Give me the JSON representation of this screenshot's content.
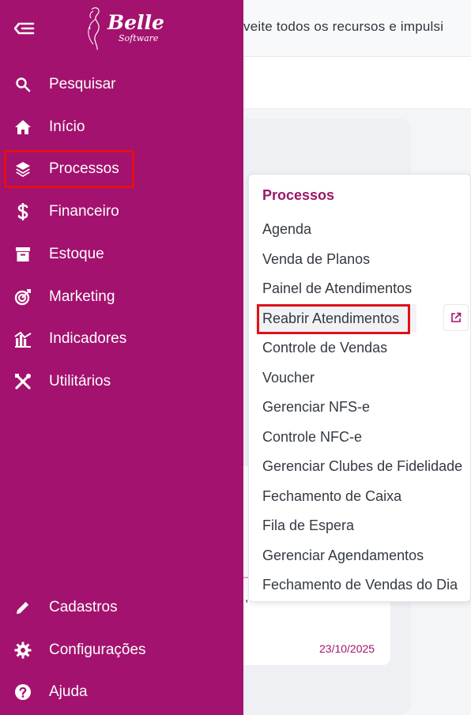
{
  "topbar": {
    "banner_text": "veite todos os recursos e impulsi"
  },
  "card": {
    "text_fragment": ",",
    "date": "23/10/2025"
  },
  "logo": {
    "name": "Belle",
    "subtitle": "Software"
  },
  "sidebar": {
    "items": [
      {
        "label": "Pesquisar",
        "icon": "search-icon"
      },
      {
        "label": "Início",
        "icon": "home-icon"
      },
      {
        "label": "Processos",
        "icon": "layers-icon"
      },
      {
        "label": "Financeiro",
        "icon": "dollar-icon"
      },
      {
        "label": "Estoque",
        "icon": "archive-icon"
      },
      {
        "label": "Marketing",
        "icon": "target-icon"
      },
      {
        "label": "Indicadores",
        "icon": "chart-icon"
      },
      {
        "label": "Utilitários",
        "icon": "tools-icon"
      }
    ],
    "bottom_items": [
      {
        "label": "Cadastros",
        "icon": "pencil-icon"
      },
      {
        "label": "Configurações",
        "icon": "gear-icon"
      },
      {
        "label": "Ajuda",
        "icon": "help-icon"
      }
    ]
  },
  "flyout": {
    "title": "Processos",
    "items": [
      "Agenda",
      "Venda de Planos",
      "Painel de Atendimentos",
      "Reabrir Atendimentos",
      "Controle de Vendas",
      "Voucher",
      "Gerenciar NFS-e",
      "Controle NFC-e",
      "Gerenciar Clubes de Fidelidade",
      "Fechamento de Caixa",
      "Fila de Espera",
      "Gerenciar Agendamentos",
      "Fechamento de Vendas do Dia"
    ]
  },
  "colors": {
    "sidebar": "#a3126e",
    "accent": "#9c1766",
    "highlight": "#e0101a"
  }
}
